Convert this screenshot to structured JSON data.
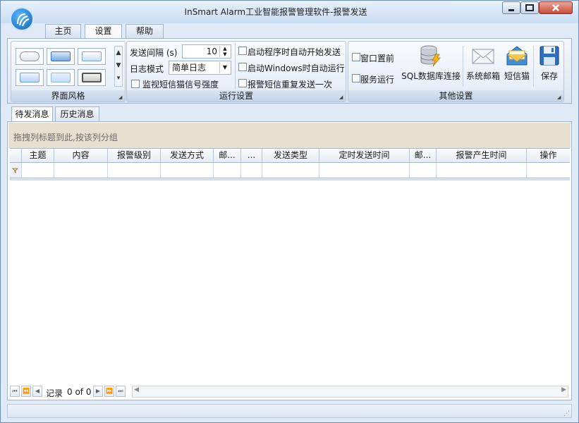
{
  "window": {
    "title": "InSmart Alarm工业智能报警管理软件-报警发送",
    "controls": {
      "minimize": "minimize",
      "maximize": "maximize",
      "close": "close"
    }
  },
  "ribbon_tabs": [
    {
      "label": "主页",
      "active": false
    },
    {
      "label": "设置",
      "active": true
    },
    {
      "label": "帮助",
      "active": false
    }
  ],
  "groups": {
    "ui_style": {
      "label": "界面风格"
    },
    "run_settings": {
      "label": "运行设置",
      "send_interval_label": "发送间隔 (s)",
      "send_interval_value": "10",
      "log_mode_label": "日志模式",
      "log_mode_value": "简单日志",
      "monitor_signal": "监视短信猫信号强度",
      "auto_send_on_start": "启动程序时自动开始发送",
      "auto_run_windows": "启动Windows时自动运行",
      "resend_alarm": "报警短信重复发送一次"
    },
    "other_settings": {
      "label": "其他设置",
      "window_top": "窗口置前",
      "service_run": "服务运行",
      "sql_connect": "SQL数据库连接",
      "system_mail": "系统邮箱",
      "sms_cat": "短信猫",
      "save": "保存"
    }
  },
  "content_tabs": [
    {
      "label": "待发消息",
      "active": true
    },
    {
      "label": "历史消息",
      "active": false
    }
  ],
  "grid": {
    "group_hint": "拖拽列标题到此,按该列分组",
    "columns": [
      "主题",
      "内容",
      "报警级别",
      "发送方式",
      "邮...",
      "...",
      "发送类型",
      "定时发送时间",
      "邮...",
      "报警产生时间",
      "操作"
    ]
  },
  "navigator": {
    "record_label": "记录",
    "record_value": "0 of 0"
  }
}
